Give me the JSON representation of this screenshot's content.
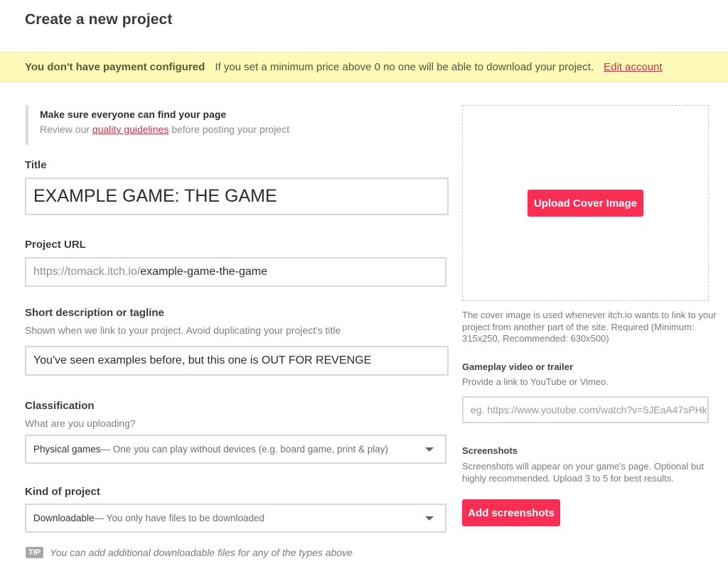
{
  "page": {
    "title": "Create a new project"
  },
  "banner": {
    "title": "You don't have payment configured",
    "text": "If you set a minimum price above 0 no one will be able to download your project.",
    "link_label": "Edit account"
  },
  "notice": {
    "title": "Make sure everyone can find your page",
    "text_before": "Review our ",
    "link_label": "quality guidelines",
    "text_after": " before posting your project"
  },
  "fields": {
    "title": {
      "label": "Title",
      "value": "EXAMPLE GAME: THE GAME"
    },
    "project_url": {
      "label": "Project URL",
      "prefix": "https://tomack.itch.io/",
      "value": "example-game-the-game"
    },
    "tagline": {
      "label": "Short description or tagline",
      "help": "Shown when we link to your project. Avoid duplicating your project's title",
      "value": "You've seen examples before, but this one is OUT FOR REVENGE"
    },
    "classification": {
      "label": "Classification",
      "help": "What are you uploading?",
      "selected_name": "Physical games",
      "selected_desc": " — One you can play without devices (e.g. board game, print & play)"
    },
    "kind": {
      "label": "Kind of project",
      "selected_name": "Downloadable",
      "selected_desc": " — You only have files to be downloaded"
    }
  },
  "tip": {
    "badge": "TIP",
    "text": "You can add additional downloadable files for any of the types above"
  },
  "cover": {
    "button_label": "Upload Cover Image",
    "help": "The cover image is used whenever itch.io wants to link to your project from another part of the site. Required (Minimum: 315x250, Recommended: 630x500)"
  },
  "video": {
    "label": "Gameplay video or trailer",
    "help": "Provide a link to YouTube or Vimeo.",
    "placeholder": "eg. https://www.youtube.com/watch?v=5JEaA47sPHk"
  },
  "screenshots": {
    "label": "Screenshots",
    "help": "Screenshots will appear on your game's page. Optional but highly recommended. Upload 3 to 5 for best results.",
    "button_label": "Add screenshots"
  },
  "colors": {
    "accent": "#fa2d55",
    "link": "#c7344e",
    "banner_bg": "#fdfab7"
  }
}
